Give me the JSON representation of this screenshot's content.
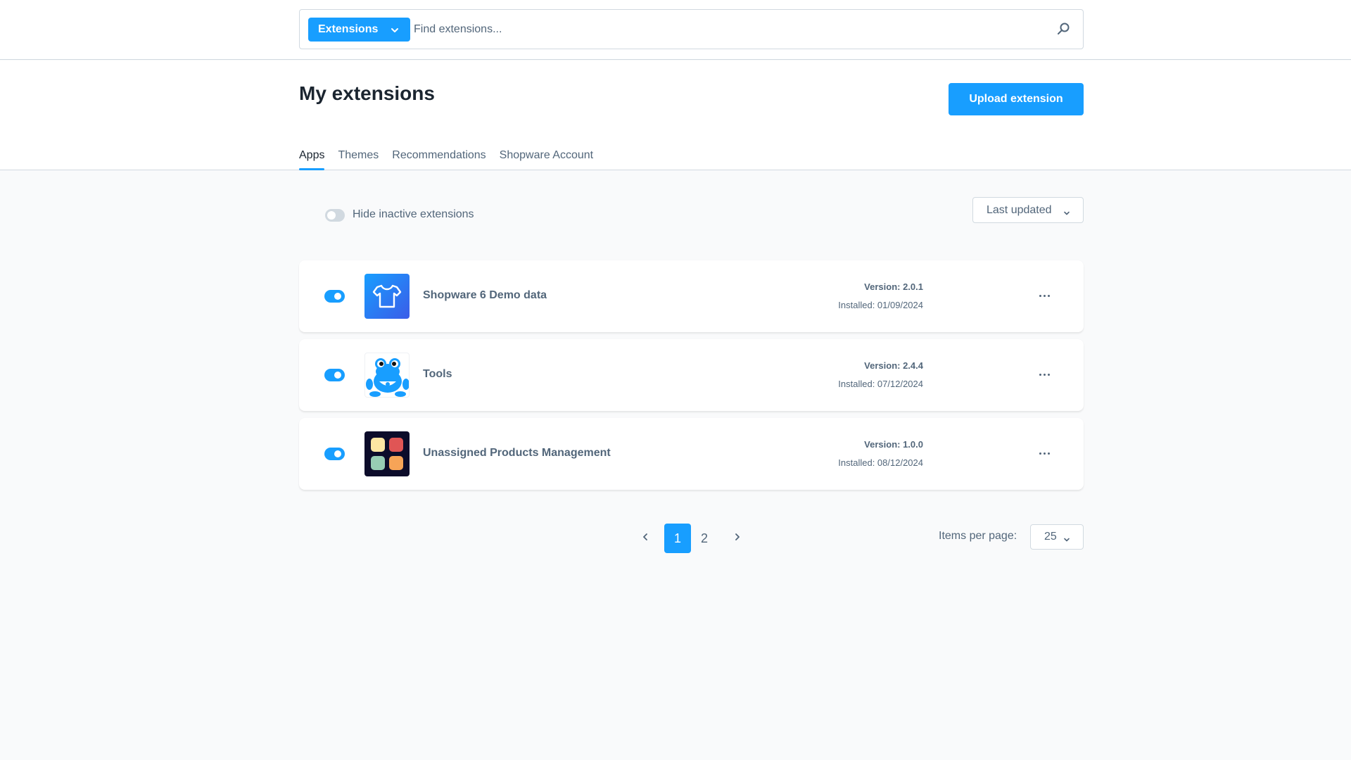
{
  "header": {
    "search_scope_label": "Extensions",
    "search_placeholder": "Find extensions..."
  },
  "page": {
    "title": "My extensions",
    "upload_button_label": "Upload extension",
    "tabs": [
      {
        "label": "Apps",
        "active": true
      },
      {
        "label": "Themes",
        "active": false
      },
      {
        "label": "Recommendations",
        "active": false
      },
      {
        "label": "Shopware Account",
        "active": false
      }
    ]
  },
  "filters": {
    "hide_inactive_label": "Hide inactive extensions",
    "hide_inactive_enabled": false,
    "sort_label": "Last updated"
  },
  "extensions": [
    {
      "name": "Shopware 6 Demo data",
      "version": "Version: 2.0.1",
      "installed": "Installed: 01/09/2024",
      "active": true,
      "icon": "tshirt-icon"
    },
    {
      "name": "Tools",
      "version": "Version: 2.4.4",
      "installed": "Installed: 07/12/2024",
      "active": true,
      "icon": "frog-mascot-icon"
    },
    {
      "name": "Unassigned Products Management",
      "version": "Version: 1.0.0",
      "installed": "Installed: 08/12/2024",
      "active": true,
      "icon": "four-squares-icon"
    }
  ],
  "pagination": {
    "pages": [
      "1",
      "2"
    ],
    "current_page": "1",
    "items_per_page_label": "Items per page:",
    "items_per_page_value": "25"
  },
  "colors": {
    "accent": "#189eff",
    "text_primary": "#1b2530",
    "text_secondary": "#52667a",
    "border": "#d1d9e0",
    "background": "#f9fafb"
  }
}
